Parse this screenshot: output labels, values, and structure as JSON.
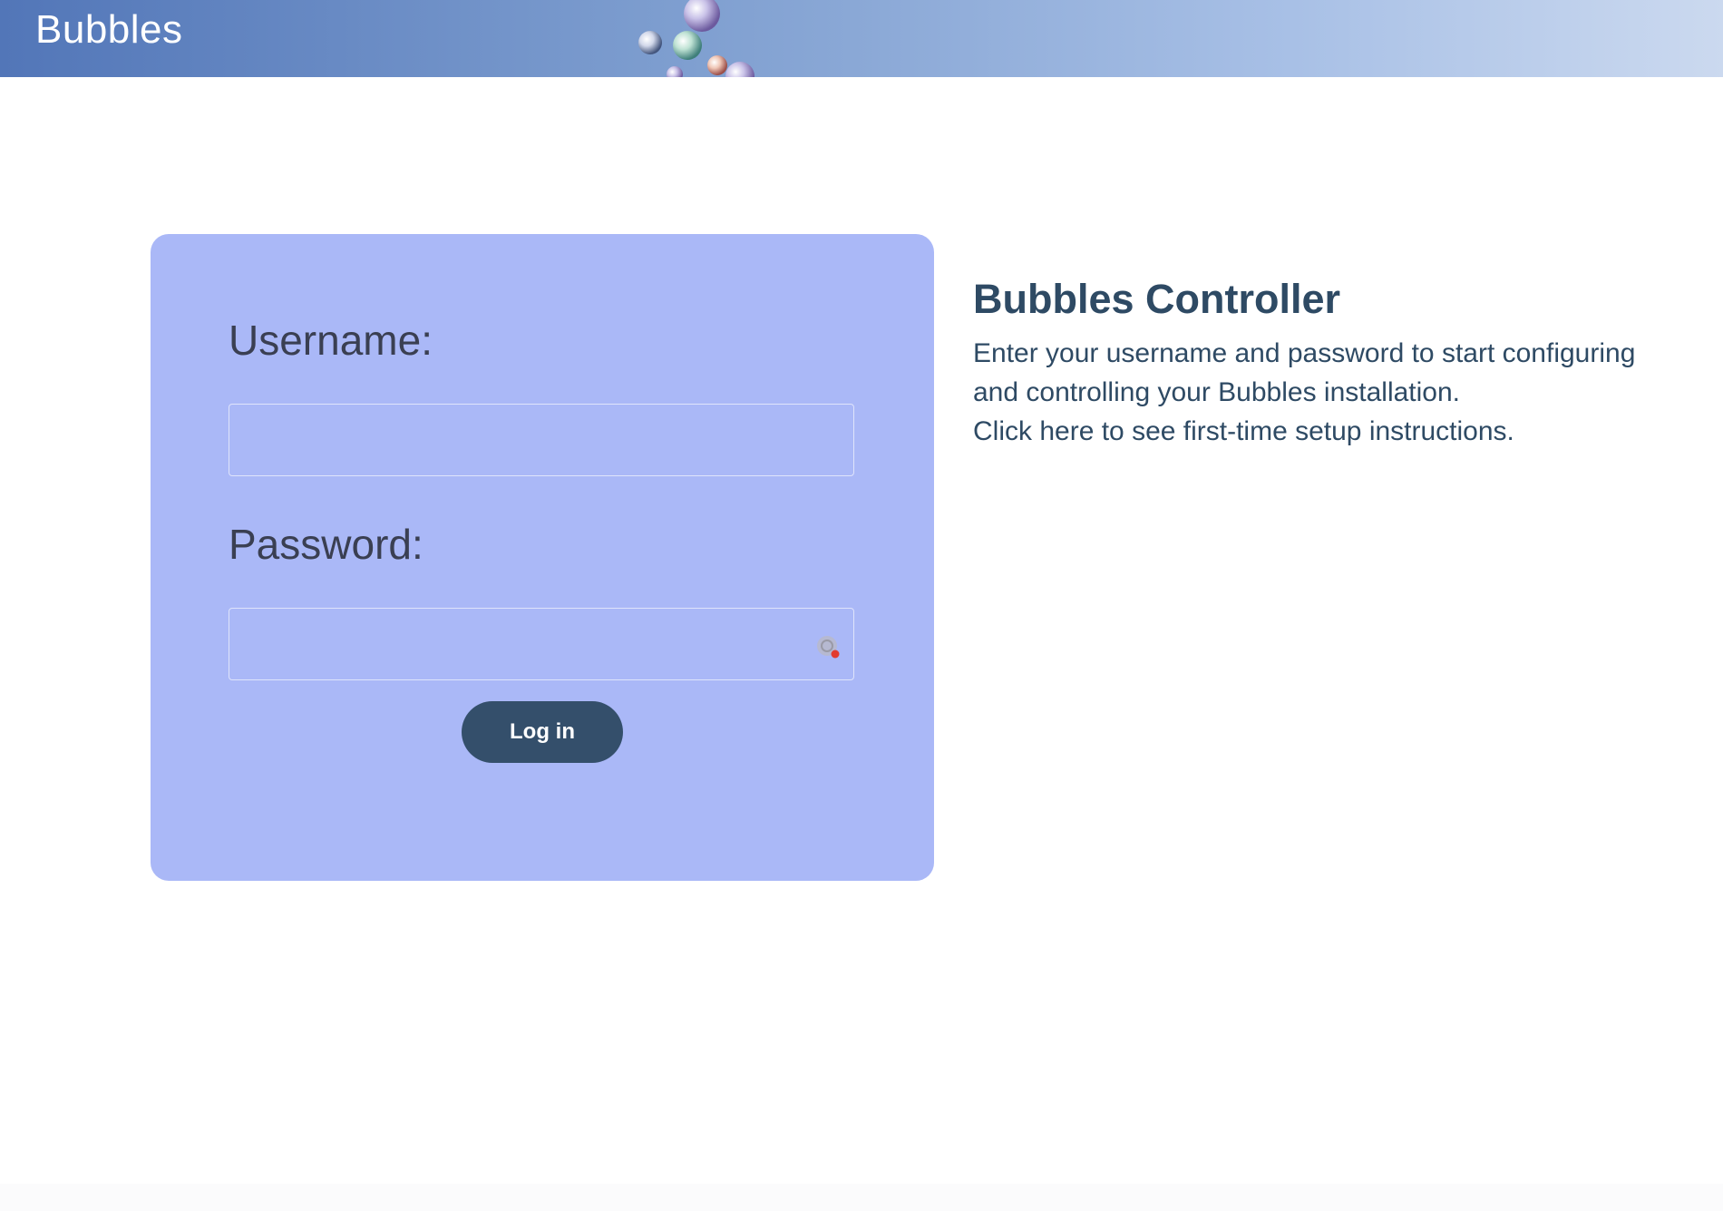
{
  "header": {
    "brand": "Bubbles",
    "background_gradient": [
      "#5276b8",
      "#cbd9ef"
    ]
  },
  "login": {
    "username_label": "Username:",
    "username_value": "",
    "password_label": "Password:",
    "password_value": "",
    "password_field_icon": "key-icon",
    "button_label": "Log in",
    "card_color": "#aab8f7",
    "button_color": "#344f6b"
  },
  "info": {
    "title": "Bubbles Controller",
    "description": "Enter your username and password to start configuring and controlling your Bubbles installation.",
    "setup_link": "Click here to see first-time setup instructions.",
    "text_color": "#2e4a64"
  }
}
